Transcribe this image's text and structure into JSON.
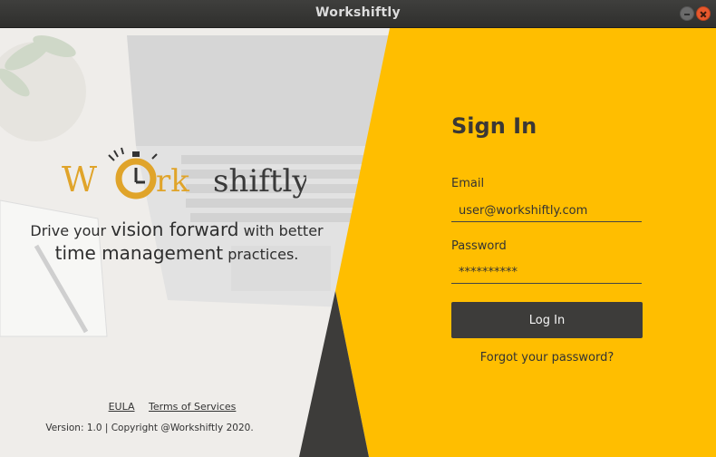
{
  "window": {
    "title": "Workshiftly"
  },
  "brand": {
    "logo_text_work_w": "W",
    "logo_text_work_rk": "rk",
    "logo_text_shiftly": "shiftly",
    "colors": {
      "accent": "#FFBE00",
      "dark": "#3D3C3A",
      "logo_gold": "#E0A42A"
    }
  },
  "tagline": {
    "part1": "Drive your",
    "part2": "vision forward",
    "part3": "with better",
    "part4": "time management",
    "part5": "practices."
  },
  "footer": {
    "eula": "EULA",
    "terms": "Terms of Services",
    "version": "Version: 1.0 | Copyright @Workshiftly 2020."
  },
  "signin": {
    "title": "Sign In",
    "email_label": "Email",
    "email_value": "user@workshiftly.com",
    "password_label": "Password",
    "password_value": "**********",
    "login_button": "Log In",
    "forgot_link": "Forgot your password?"
  }
}
